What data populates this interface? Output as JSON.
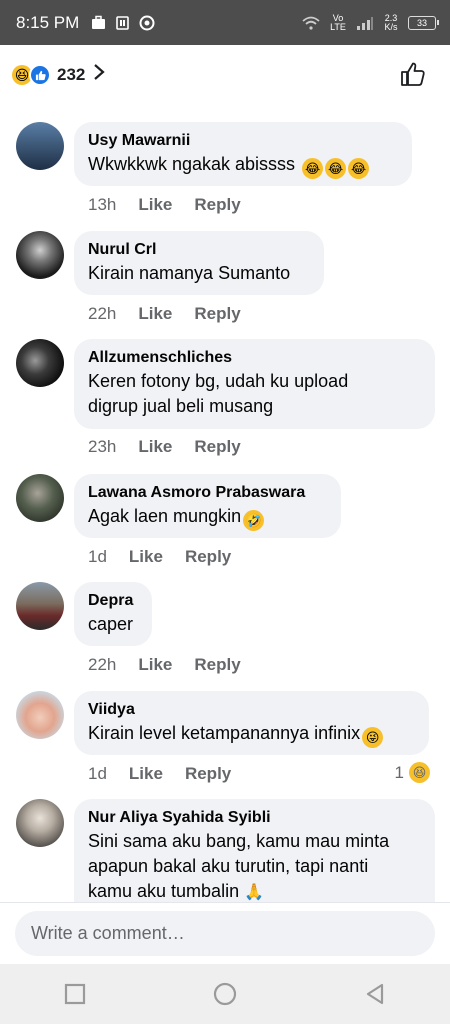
{
  "status_bar": {
    "time": "8:15 PM",
    "network": "Vo LTE",
    "speed": "2.3 K/s",
    "battery": "33"
  },
  "header": {
    "reaction_count": "232",
    "reaction_icons": [
      "laughing-emoji",
      "like-thumb"
    ]
  },
  "comments": [
    {
      "name": "Usy Mawarnii",
      "text": "Wkwkkwk ngakak abissss",
      "emoji_count": 3,
      "time": "13h",
      "like": "Like",
      "reply": "Reply",
      "avatar_color": "#2f4c6f"
    },
    {
      "name": "Nurul Crl",
      "text": "Kirain namanya Sumanto",
      "time": "22h",
      "like": "Like",
      "reply": "Reply",
      "avatar_color": "#3a3a3a"
    },
    {
      "name": "Allzumenschliches",
      "text_lines": [
        "Keren fotony bg, udah ku upload",
        "digrup jual beli musang"
      ],
      "time": "23h",
      "like": "Like",
      "reply": "Reply",
      "avatar_color": "#222222"
    },
    {
      "name": "Lawana Asmoro Prabaswara",
      "text": "Agak laen mungkin",
      "time": "1d",
      "like": "Like",
      "reply": "Reply",
      "avatar_color": "#4a5a45"
    },
    {
      "name": "Depra",
      "text": "caper",
      "time": "22h",
      "like": "Like",
      "reply": "Reply",
      "avatar_color": "#6b3a3a"
    },
    {
      "name": "Viidya",
      "text": "Kirain level ketampanannya infinix",
      "time": "1d",
      "like": "Like",
      "reply": "Reply",
      "reaction_count": "1",
      "avatar_color": "#d9a38a"
    },
    {
      "name": "Nur Aliya Syahida Syibli",
      "text_lines": [
        "Sini sama aku bang, kamu mau minta",
        "apapun bakal aku turutin, tapi nanti",
        "kamu aku tumbalin"
      ],
      "avatar_color": "#8a8a8a"
    }
  ],
  "composer": {
    "placeholder": "Write a comment…"
  },
  "colors": {
    "bubble": "#f0f2f5",
    "meta": "#65676b",
    "haha": "#f7c02b",
    "like_blue": "#1b74e4"
  }
}
